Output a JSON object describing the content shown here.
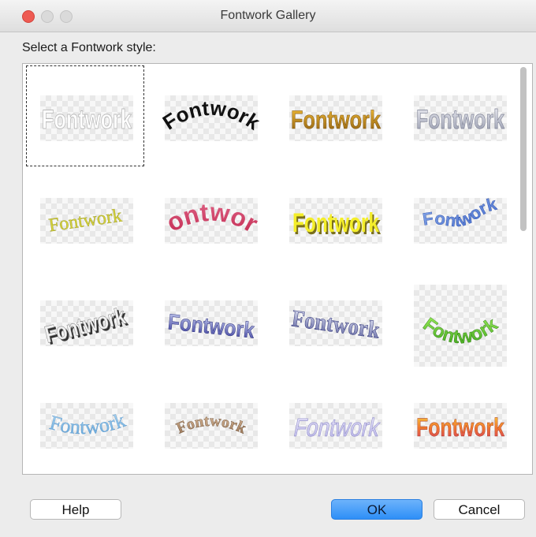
{
  "window": {
    "title": "Fontwork Gallery",
    "controls": [
      "close",
      "minimize",
      "maximize"
    ]
  },
  "prompt": "Select a Fontwork style:",
  "gallery": {
    "selected_index": 0,
    "styles": [
      {
        "text": "Fontwork",
        "icon": "fontwork-outline-plain"
      },
      {
        "text": "Fontwork",
        "icon": "fontwork-black-arch"
      },
      {
        "text": "Fontwork",
        "icon": "fontwork-gold-gradient"
      },
      {
        "text": "Fontwork",
        "icon": "fontwork-silver-condensed"
      },
      {
        "text": "Fontwork",
        "icon": "fontwork-yellow-serif-slant"
      },
      {
        "text": "Fontwork",
        "icon": "fontwork-pink-perspective"
      },
      {
        "text": "Fontwork",
        "icon": "fontwork-yellow-3d"
      },
      {
        "text": "Fontwork",
        "icon": "fontwork-blue-wave"
      },
      {
        "text": "Fontwork",
        "icon": "fontwork-gray-3d-rise"
      },
      {
        "text": "Fontwork",
        "icon": "fontwork-blue-purple-3d"
      },
      {
        "text": "Fontwork",
        "icon": "fontwork-blue-gray-serif-3d"
      },
      {
        "text": "Fontwork",
        "icon": "fontwork-green-arc"
      },
      {
        "text": "Fontwork",
        "icon": "fontwork-lightblue-serif-bend"
      },
      {
        "text": "Fontwork",
        "icon": "fontwork-bronze-arch"
      },
      {
        "text": "Fontwork",
        "icon": "fontwork-lavender-skew"
      },
      {
        "text": "Fontwork",
        "icon": "fontwork-orange-gradient"
      }
    ]
  },
  "buttons": {
    "help": "Help",
    "ok": "OK",
    "cancel": "Cancel"
  },
  "colors": {
    "accent": "#2e8ff7",
    "close": "#ee5a52"
  }
}
